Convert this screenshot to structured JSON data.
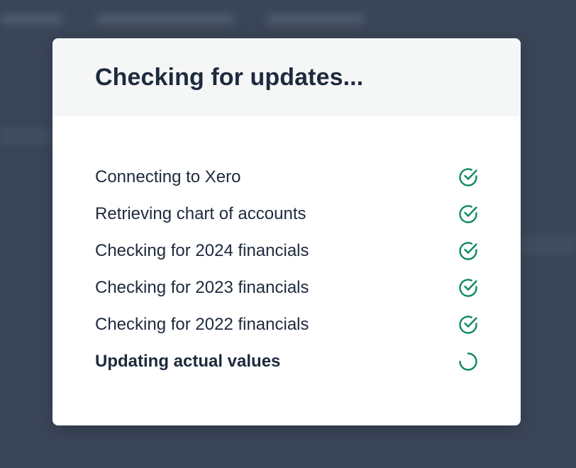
{
  "modal": {
    "title": "Checking for updates..."
  },
  "steps": [
    {
      "label": "Connecting to Xero",
      "status": "complete"
    },
    {
      "label": "Retrieving chart of accounts",
      "status": "complete"
    },
    {
      "label": "Checking for 2024 financials",
      "status": "complete"
    },
    {
      "label": "Checking for 2023 financials",
      "status": "complete"
    },
    {
      "label": "Checking for 2022 financials",
      "status": "complete"
    },
    {
      "label": "Updating actual values",
      "status": "in-progress"
    }
  ],
  "colors": {
    "accent": "#0e8a5f",
    "text": "#1e2a3d",
    "header_bg": "#f5f7f7",
    "overlay": "#3a4558"
  },
  "icons": {
    "complete": "check-circle-icon",
    "in_progress": "spinner-icon"
  }
}
